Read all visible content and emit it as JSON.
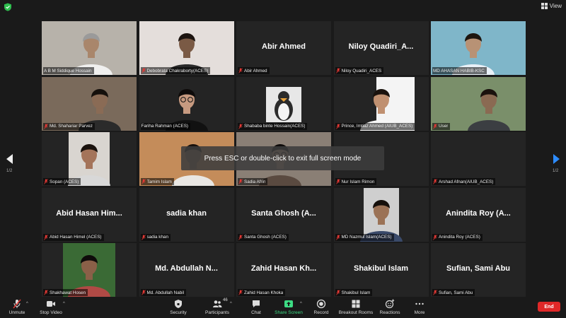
{
  "topbar": {
    "view_label": "View"
  },
  "hint": "Press ESC or double-click to exit full screen mode",
  "pager": {
    "left_label": "1/2",
    "right_label": "1/2"
  },
  "tiles": [
    {
      "name": "A B M Siddique Hossain",
      "big": "",
      "video": true,
      "muted": false,
      "active": false
    },
    {
      "name": "Debobrata Chakraborty(ACES)",
      "big": "",
      "video": true,
      "muted": true,
      "active": false
    },
    {
      "name": "Abir Ahmed",
      "big": "Abir Ahmed",
      "video": false,
      "muted": true,
      "active": false
    },
    {
      "name": "Niloy Quadiri_ACES",
      "big": "Niloy Quadiri_A...",
      "video": false,
      "muted": true,
      "active": false
    },
    {
      "name": "MD AHASAN HABIB-KSC",
      "big": "",
      "video": true,
      "muted": false,
      "active": false
    },
    {
      "name": "Md. Shahariar Parvez",
      "big": "",
      "video": true,
      "muted": true,
      "active": false
    },
    {
      "name": "Fariha Rahman (ACES)",
      "big": "",
      "video": true,
      "muted": false,
      "active": true
    },
    {
      "name": "Shababa binte Hossain(ACES)",
      "big": "",
      "video": true,
      "muted": true,
      "active": false
    },
    {
      "name": "Prince, Imtiaz Ahmed (AIUB_ACES)",
      "big": "",
      "video": true,
      "muted": true,
      "active": false
    },
    {
      "name": "User",
      "big": "",
      "video": true,
      "muted": true,
      "active": false
    },
    {
      "name": "Sopan (ACES)",
      "big": "",
      "video": true,
      "muted": true,
      "active": false
    },
    {
      "name": "Tamim Islam",
      "big": "",
      "video": true,
      "muted": true,
      "active": false
    },
    {
      "name": "Sadia Afrin",
      "big": "",
      "video": true,
      "muted": true,
      "active": false
    },
    {
      "name": "Nur Islam Rimon",
      "big": "",
      "video": false,
      "muted": true,
      "active": false
    },
    {
      "name": "Arshad Afnan(AIUB_ACES)",
      "big": "",
      "video": false,
      "muted": true,
      "active": false
    },
    {
      "name": "Abid Hasan Himel (ACES)",
      "big": "Abid Hasan Him...",
      "video": false,
      "muted": true,
      "active": false
    },
    {
      "name": "sadia khan",
      "big": "sadia khan",
      "video": false,
      "muted": true,
      "active": false
    },
    {
      "name": "Santa Ghosh (ACES)",
      "big": "Santa Ghosh (A...",
      "video": false,
      "muted": true,
      "active": false
    },
    {
      "name": "MD Nazmul Islam(ACES)",
      "big": "",
      "video": true,
      "muted": true,
      "active": false
    },
    {
      "name": "Anindita Roy (ACES)",
      "big": "Anindita Roy (A...",
      "video": false,
      "muted": true,
      "active": false
    },
    {
      "name": "Shakhawat Hosen",
      "big": "",
      "video": true,
      "muted": true,
      "active": false
    },
    {
      "name": "Md. Abdullah Nabil",
      "big": "Md. Abdullah N...",
      "video": false,
      "muted": true,
      "active": false
    },
    {
      "name": "Zahid Hasan Khoka",
      "big": "Zahid Hasan Kh...",
      "video": false,
      "muted": true,
      "active": false
    },
    {
      "name": "Shakibul Islam",
      "big": "Shakibul Islam",
      "video": false,
      "muted": true,
      "active": false
    },
    {
      "name": "Sufian, Sami Abu",
      "big": "Sufian, Sami Abu",
      "video": false,
      "muted": true,
      "active": false
    }
  ],
  "toolbar": {
    "unmute": "Unmute",
    "stop_video": "Stop Video",
    "security": "Security",
    "participants": "Participants",
    "participants_count": "46",
    "chat": "Chat",
    "share_screen": "Share Screen",
    "record": "Record",
    "breakout_rooms": "Breakout Rooms",
    "reactions": "Reactions",
    "more": "More",
    "end": "End"
  },
  "colors": {
    "active_border": "#c9e64d",
    "end_button": "#e02828",
    "share_green": "#3ddc84",
    "mute_red": "#e53935"
  }
}
